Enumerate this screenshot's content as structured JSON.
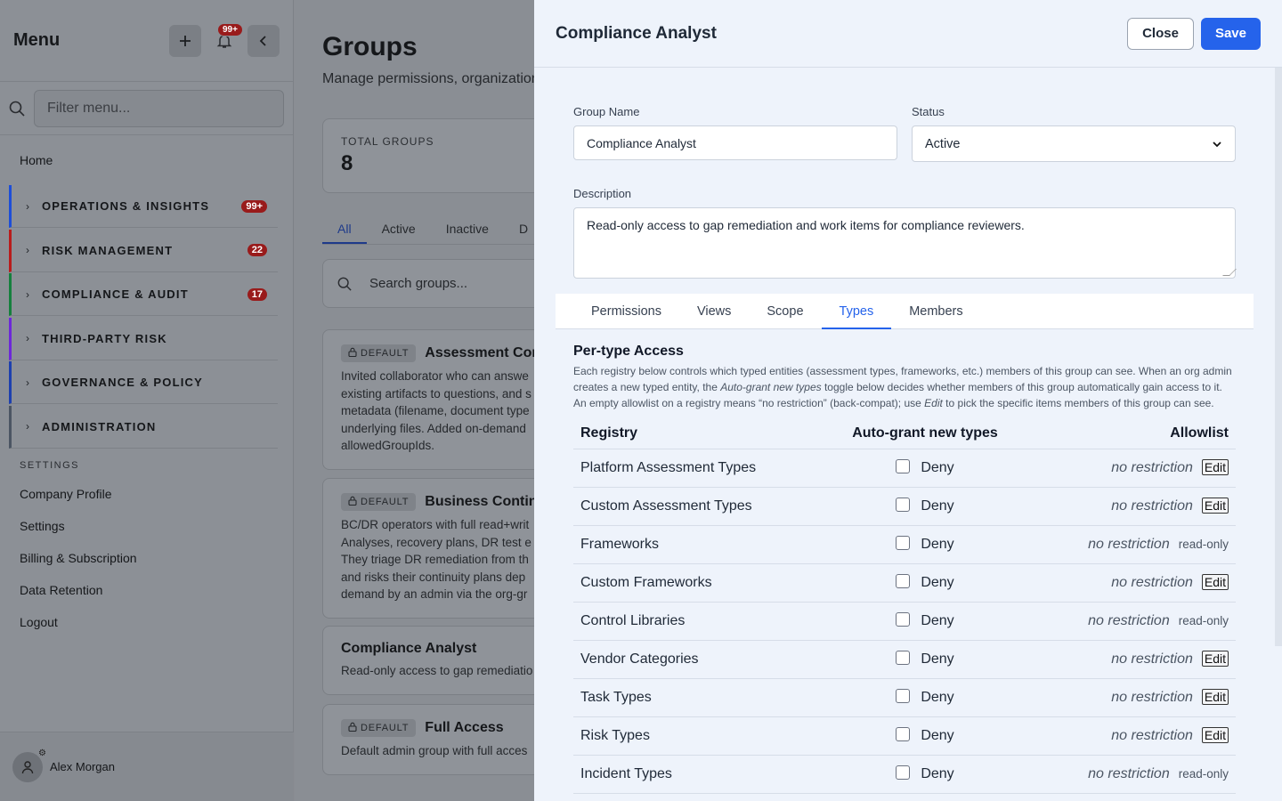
{
  "sidebar": {
    "title": "Menu",
    "bell_badge": "99+",
    "filter_placeholder": "Filter menu...",
    "home": "Home",
    "groups": [
      {
        "label": "OPERATIONS & INSIGHTS",
        "badge": "99+",
        "color": "#1d4ed8"
      },
      {
        "label": "RISK MANAGEMENT",
        "badge": "22",
        "color": "#b91c1c"
      },
      {
        "label": "COMPLIANCE & AUDIT",
        "badge": "17",
        "color": "#15803d"
      },
      {
        "label": "THIRD-PARTY RISK",
        "badge": "",
        "color": "#6d28d9"
      },
      {
        "label": "GOVERNANCE & POLICY",
        "badge": "",
        "color": "#1e40af"
      },
      {
        "label": "ADMINISTRATION",
        "badge": "",
        "color": "#4b5563"
      }
    ],
    "settings_title": "SETTINGS",
    "links": [
      "Company Profile",
      "Settings",
      "Billing & Subscription",
      "Data Retention",
      "Logout"
    ],
    "user_name": "Alex Morgan"
  },
  "main": {
    "title": "Groups",
    "subtitle": "Manage permissions, organization",
    "stat_label": "TOTAL GROUPS",
    "stat_value": "8",
    "tabs": [
      "All",
      "Active",
      "Inactive",
      "D"
    ],
    "search_placeholder": "Search groups...",
    "cards": [
      {
        "default": "DEFAULT",
        "name": "Assessment Cont",
        "desc": [
          "Invited collaborator who can answe",
          "existing artifacts to questions, and s",
          "metadata (filename, document type",
          "underlying files. Added on-demand",
          "allowedGroupIds."
        ]
      },
      {
        "default": "DEFAULT",
        "name": "Business Continu",
        "desc": [
          "BC/DR operators with full read+writ",
          "Analyses, recovery plans, DR test e",
          "They triage DR remediation from th",
          "and risks their continuity plans dep",
          "demand by an admin via the org-gr"
        ]
      },
      {
        "default": "",
        "name": "Compliance Analyst",
        "desc": [
          "Read-only access to gap remediatio"
        ]
      },
      {
        "default": "DEFAULT",
        "name": "Full Access",
        "desc": [
          "Default admin group with full acces"
        ]
      }
    ]
  },
  "drawer": {
    "title": "Compliance Analyst",
    "close_label": "Close",
    "save_label": "Save",
    "group_name_label": "Group Name",
    "group_name_value": "Compliance Analyst",
    "status_label": "Status",
    "status_value": "Active",
    "description_label": "Description",
    "description_value": "Read-only access to gap remediation and work items for compliance reviewers.",
    "tabs": [
      "Permissions",
      "Views",
      "Scope",
      "Types",
      "Members"
    ],
    "active_tab": "Types",
    "types_title": "Per-type Access",
    "help_1": "Each registry below controls which typed entities (assessment types, frameworks, etc.) members of this group can see. When an org admin creates a new typed entity, the ",
    "help_em1": "Auto-grant new types",
    "help_2": " toggle below decides whether members of this group automatically gain access to it. An empty allowlist on a registry means “no restriction” (back-compat); use ",
    "help_em2": "Edit",
    "help_3": " to pick the specific items members of this group can see.",
    "col_registry": "Registry",
    "col_auto": "Auto-grant new types",
    "col_allow": "Allowlist",
    "deny_label": "Deny",
    "no_restriction": "no restriction",
    "edit_label": "Edit",
    "readonly_label": "read-only",
    "rows": [
      {
        "name": "Platform Assessment Types",
        "editable": true
      },
      {
        "name": "Custom Assessment Types",
        "editable": true
      },
      {
        "name": "Frameworks",
        "editable": false
      },
      {
        "name": "Custom Frameworks",
        "editable": true
      },
      {
        "name": "Control Libraries",
        "editable": false
      },
      {
        "name": "Vendor Categories",
        "editable": true
      },
      {
        "name": "Task Types",
        "editable": true
      },
      {
        "name": "Risk Types",
        "editable": true
      },
      {
        "name": "Incident Types",
        "editable": false
      }
    ]
  }
}
